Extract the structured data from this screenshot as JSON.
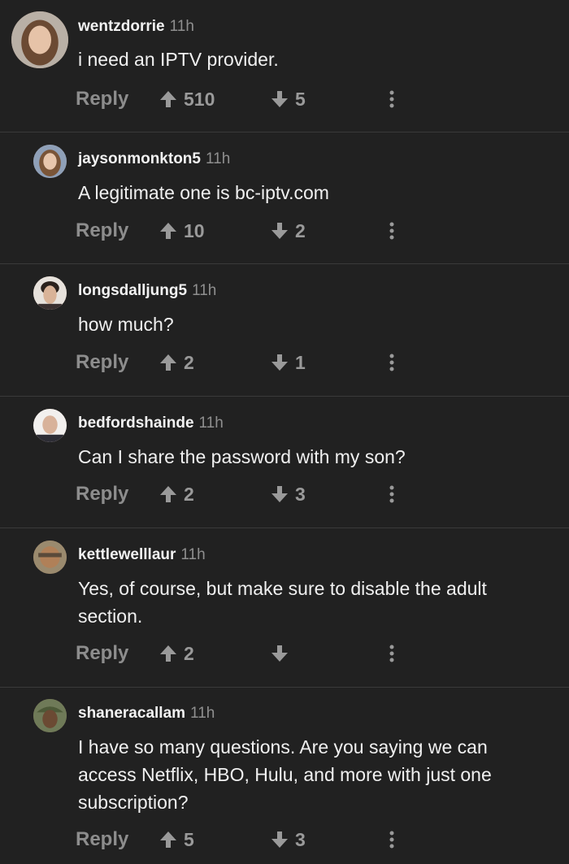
{
  "comments": [
    {
      "username": "wentzdorrie",
      "time": "11h",
      "text": "i need an IPTV provider.",
      "reply": "Reply",
      "upvotes": "510",
      "downvotes": "5"
    },
    {
      "username": "jaysonmonkton5",
      "time": "11h",
      "text": "A legitimate one is bc-iptv.com",
      "reply": "Reply",
      "upvotes": "10",
      "downvotes": "2"
    },
    {
      "username": "longsdalljung5",
      "time": "11h",
      "text": "how much?",
      "reply": "Reply",
      "upvotes": "2",
      "downvotes": "1"
    },
    {
      "username": "bedfordshainde",
      "time": "11h",
      "text": "Can I share the password with my son?",
      "reply": "Reply",
      "upvotes": "2",
      "downvotes": "3"
    },
    {
      "username": "kettlewelllaur",
      "time": "11h",
      "text": "Yes, of course, but make sure to disable the adult section.",
      "reply": "Reply",
      "upvotes": "2",
      "downvotes": ""
    },
    {
      "username": "shaneracallam",
      "time": "11h",
      "text": "I have so many questions. Are you saying we can access Netflix, HBO, Hulu, and more with just one subscription?",
      "reply": "Reply",
      "upvotes": "5",
      "downvotes": "3"
    }
  ],
  "icons": {
    "upvote": "arrow-up-icon",
    "downvote": "arrow-down-icon",
    "more": "more-vertical-icon"
  },
  "colors": {
    "background": "#212121",
    "divider": "#3a3a3a",
    "muted": "#8d8d8d"
  }
}
